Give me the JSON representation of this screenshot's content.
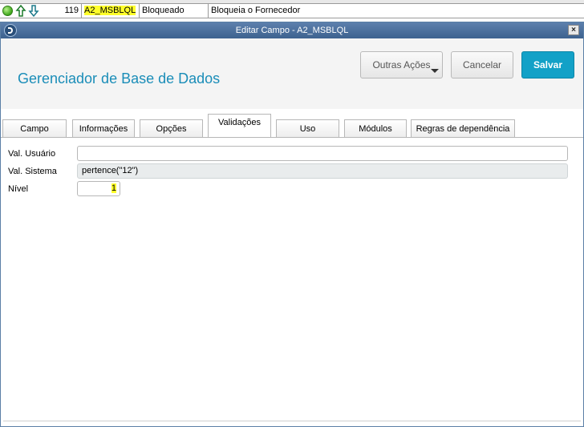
{
  "background_row": {
    "number": "119",
    "field": "A2_MSBLQL",
    "title": "Bloqueado",
    "description": "Bloqueia o Fornecedor"
  },
  "dialog": {
    "window_title": "Editar Campo - A2_MSBLQL",
    "close_glyph": "×",
    "app_title": "Gerenciador de Base de Dados",
    "buttons": {
      "more_actions": "Outras Ações",
      "cancel": "Cancelar",
      "save": "Salvar"
    },
    "tabs": [
      {
        "label": "Campo"
      },
      {
        "label": "Informações"
      },
      {
        "label": "Opções"
      },
      {
        "label": "Validações"
      },
      {
        "label": "Uso"
      },
      {
        "label": "Módulos"
      },
      {
        "label": "Regras de dependência"
      }
    ],
    "active_tab": "Validações",
    "form": {
      "user_validation_label": "Val. Usuário",
      "user_validation_value": "",
      "system_validation_label": "Val. Sistema",
      "system_validation_value": "pertence(\"12\")",
      "level_label": "Nível",
      "level_value": "1"
    }
  },
  "colors": {
    "title_accent": "#1a8db8",
    "save_button": "#13a1c7",
    "highlight": "#ffff2a"
  }
}
